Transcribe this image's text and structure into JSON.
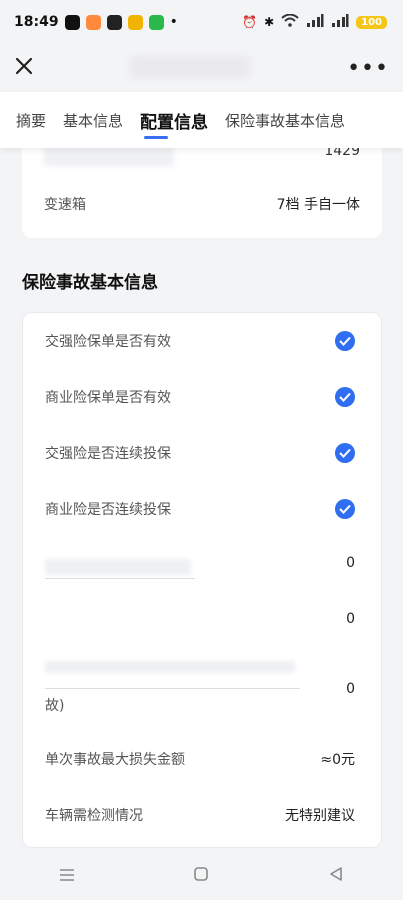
{
  "status_bar": {
    "time": "18:49",
    "battery": "100"
  },
  "tabs": [
    {
      "label": "摘要"
    },
    {
      "label": "基本信息"
    },
    {
      "label": "配置信息"
    },
    {
      "label": "保险事故基本信息"
    }
  ],
  "config": {
    "partial_value": "1429",
    "transmission_label": "变速箱",
    "transmission_value": "7档 手自一体"
  },
  "section_title": "保险事故基本信息",
  "insurance_rows": [
    {
      "label": "交强险保单是否有效",
      "checked": true
    },
    {
      "label": "商业险保单是否有效",
      "checked": true
    },
    {
      "label": "交强险是否连续投保",
      "checked": true
    },
    {
      "label": "商业险是否连续投保",
      "checked": true
    }
  ],
  "count_values": [
    "0",
    "0",
    "0"
  ],
  "wrapped_label_tail": "故)",
  "max_loss_label": "单次事故最大损失金额",
  "max_loss_value": "≈0元",
  "inspection_label": "车辆需检测情况",
  "inspection_value": "无特别建议"
}
